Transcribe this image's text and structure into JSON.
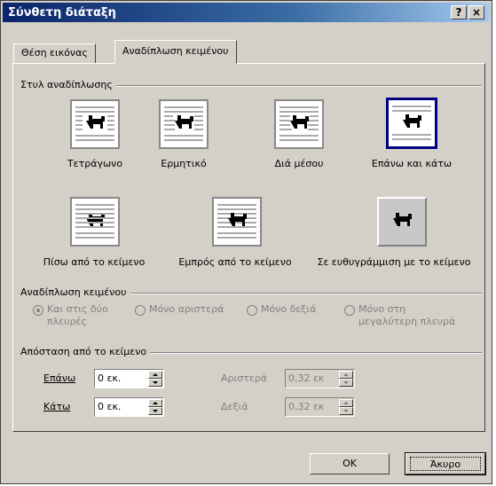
{
  "window": {
    "title": "Σύνθετη διάταξη",
    "help_label": "?",
    "close_label": "×"
  },
  "tabs": [
    {
      "label": "Θέση εικόνας"
    },
    {
      "label": "Αναδίπλωση κειμένου"
    }
  ],
  "wrap_style": {
    "group_label": "Στυλ αναδίπλωσης",
    "options": [
      {
        "label": "Τετράγωνο",
        "icon": "square-wrap-icon"
      },
      {
        "label": "Ερμητικό",
        "icon": "tight-wrap-icon"
      },
      {
        "label": "Διά μέσου",
        "icon": "through-wrap-icon"
      },
      {
        "label": "Επάνω και κάτω",
        "icon": "top-bottom-wrap-icon",
        "selected": true
      },
      {
        "label": "Πίσω από το κείμενο",
        "icon": "behind-text-icon"
      },
      {
        "label": "Εμπρός από το κείμενο",
        "icon": "in-front-text-icon"
      },
      {
        "label": "Σε ευθυγράμμιση με το κείμενο",
        "icon": "inline-text-icon"
      }
    ]
  },
  "wrap_text": {
    "group_label": "Αναδίπλωση κειμένου",
    "both_sides": "Και στις δύο\nπλευρές",
    "left_only": "Μόνο αριστερά",
    "right_only": "Μόνο δεξιά",
    "largest_only": "Μόνο στη\nμεγαλύτερη πλευρά"
  },
  "distance": {
    "group_label": "Απόσταση από το κείμενο",
    "top_label": "Επάνω",
    "top_value": "0 εκ.",
    "bottom_label": "Κάτω",
    "bottom_value": "0 εκ.",
    "left_label": "Αριστερά",
    "left_value": "0,32 εκ",
    "right_label": "Δεξιά",
    "right_value": "0,32 εκ"
  },
  "buttons": {
    "ok": "OK",
    "cancel": "Άκυρο"
  },
  "colors": {
    "title_bar": "#0a246a",
    "face": "#d4d0c8",
    "selection_border": "#000080"
  }
}
